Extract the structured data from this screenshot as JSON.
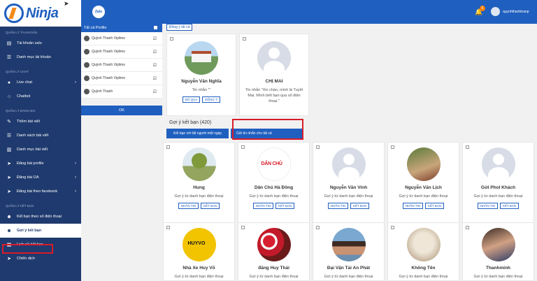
{
  "sidebar": {
    "logo_text": "Ninja",
    "sections": [
      {
        "title": "QUẢN LÝ TÀI KHOẢN",
        "items": [
          {
            "label": "Tài khoản zalo",
            "icon": "id-card-icon"
          },
          {
            "label": "Danh mục tài khoản",
            "icon": "list-icon"
          }
        ]
      },
      {
        "title": "QUẢN LÝ CHAT",
        "items": [
          {
            "label": "Live chat",
            "icon": "chat-icon",
            "has_sub": true
          },
          {
            "label": "Chatbot",
            "icon": "chatbot-icon"
          }
        ]
      },
      {
        "title": "QUẢN LÝ ĐĂNG BÀI",
        "items": [
          {
            "label": "Thêm bài viết",
            "icon": "edit-icon"
          },
          {
            "label": "Danh sách bài viết",
            "icon": "list-icon"
          },
          {
            "label": "Danh mục bài viết",
            "icon": "folder-icon"
          },
          {
            "label": "Đăng bài profile",
            "icon": "send-icon",
            "has_sub": true
          },
          {
            "label": "Đăng bài OA",
            "icon": "send-icon",
            "has_sub": true
          },
          {
            "label": "Đăng bài theo facebook",
            "icon": "send-icon",
            "has_sub": true
          }
        ]
      },
      {
        "title": "QUẢN LÝ KẾT BẠN",
        "items": [
          {
            "label": "Kết bạn theo số điện thoại",
            "icon": "user-plus-icon"
          },
          {
            "label": "Gợi ý kết bạn",
            "icon": "user-suggest-icon",
            "active": true
          },
          {
            "label": "Lịch sử kết bạn",
            "icon": "history-icon"
          },
          {
            "label": "Chiến dịch",
            "icon": "send-icon"
          }
        ]
      }
    ]
  },
  "topbar": {
    "zalo_label": "Zalo",
    "notification_count": "5",
    "username": "quynhthanhtranp"
  },
  "profiles": {
    "header": "Tất cả Profile",
    "items": [
      {
        "name": "Quỳnh Thanh Viplimo"
      },
      {
        "name": "Quỳnh Thanh Viplimo"
      },
      {
        "name": "Quỳnh Thanh Viplimo"
      },
      {
        "name": "Quỳnh Thanh Viplimo"
      },
      {
        "name": "Quỳnh Thanh"
      }
    ],
    "ok_label": "OK"
  },
  "requests": {
    "accept_all_label": "Đồng ý tất cả",
    "cards": [
      {
        "name": "Nguyễn Văn Nghĩa",
        "message": "Tin nhắn \"\"",
        "skip_label": "BỎ QUA",
        "accept_label": "ĐỒNG Ý"
      },
      {
        "name": "CHỊ MAI",
        "message": "Tin nhắn \"Xin chào, mình là Tuyết Mai. Mình biết bạn qua số điện thoại.\""
      }
    ]
  },
  "suggestions": {
    "title": "Gợi ý kết bạn (420)",
    "add_all_label": "Kết bạn với tất người một ngày",
    "message_all_label": "Gửi tin nhắn cho tất cả",
    "desc": "Gợi ý từ danh bạn điện thoại",
    "message_label": "NHẮN TIN",
    "add_label": "KẾT BẠN",
    "row1": [
      "Hung",
      "Dân Chủ Hà Đông",
      "Nguyễn Văn Vinh",
      "Nguyễn Văn Lịch",
      "Gửi Phol Khách"
    ],
    "row2": [
      "Nhà Xe Huy Võ",
      "đăng Huy Thái",
      "Đại Vận Tải An Phát",
      "Không Tên",
      "Thanhminh"
    ]
  }
}
